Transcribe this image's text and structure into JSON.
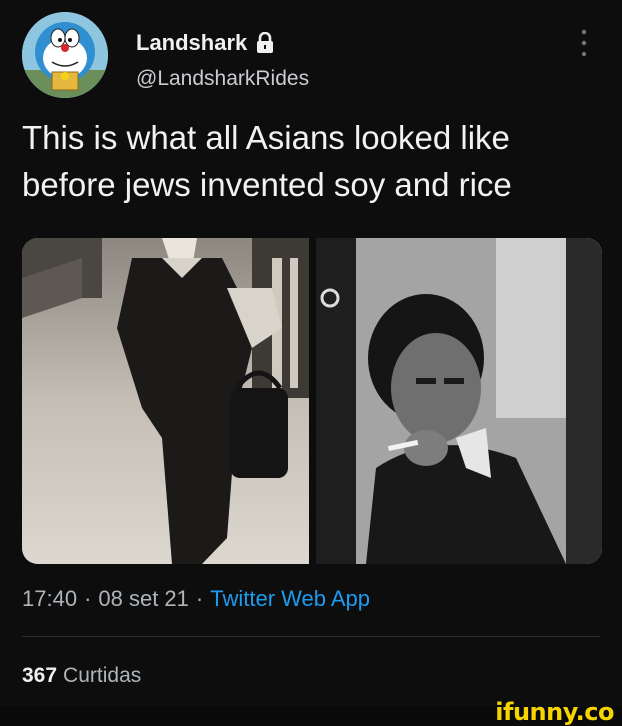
{
  "user": {
    "display_name": "Landshark",
    "handle": "@LandsharkRides",
    "avatar_icon": "doraemon-avatar",
    "protected_icon": "lock-icon"
  },
  "tweet": {
    "text": "This is what all Asians looked like before jews invented soy and rice",
    "photos": [
      "man-walking-photo",
      "man-smoking-photo"
    ]
  },
  "meta": {
    "time": "17:40",
    "date": "08 set 21",
    "app": "Twitter Web App"
  },
  "stats": {
    "likes_count": "367",
    "likes_label": "Curtidas"
  },
  "watermark": "ifunny.co",
  "colors": {
    "background": "#0d0d0d",
    "link": "#1d9bf0",
    "watermark": "#f5d400"
  }
}
